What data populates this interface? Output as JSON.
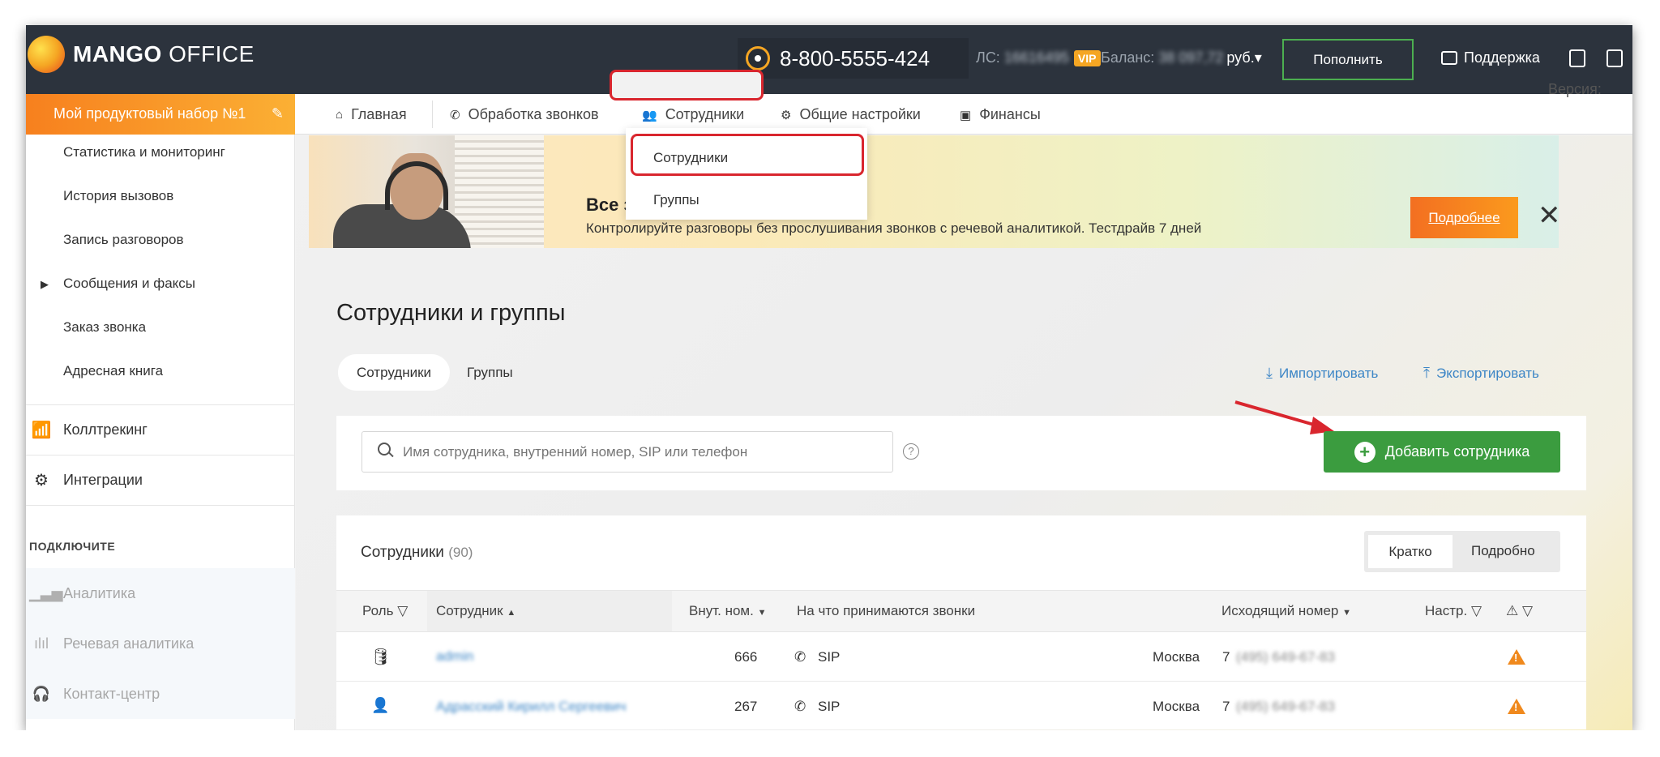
{
  "topbar": {
    "logo_bold": "MANGO",
    "logo_light": " OFFICE",
    "phone": "8-800-5555-424",
    "ls_label": "ЛС:",
    "ls_value": "16616495",
    "vip": "VIP",
    "balance_label": "Баланс:",
    "balance_value": "38 097,72",
    "balance_currency": "руб.▾",
    "topup_label": "Пополнить",
    "support_label": "Поддержка"
  },
  "sidebar": {
    "product_set": "Мой продуктовый набор №1",
    "items": [
      {
        "label": "Статистика и мониторинг"
      },
      {
        "label": "История вызовов"
      },
      {
        "label": "Запись разговоров"
      },
      {
        "label": "Сообщения и факсы"
      },
      {
        "label": "Заказ звонка"
      },
      {
        "label": "Адресная книга"
      }
    ],
    "big_items": [
      {
        "label": "Коллтрекинг",
        "icon": "calltracking-icon"
      },
      {
        "label": "Интеграции",
        "icon": "integrations-icon"
      }
    ],
    "section_title": "ПОДКЛЮЧИТЕ",
    "connect_items": [
      {
        "label": "Аналитика",
        "icon": "bar-chart-icon"
      },
      {
        "label": "Речевая аналитика",
        "icon": "waveform-icon"
      },
      {
        "label": "Контакт-центр",
        "icon": "headset-icon"
      }
    ]
  },
  "nav": {
    "home": "Главная",
    "calls": "Обработка звонков",
    "employees": "Сотрудники",
    "settings": "Общие настройки",
    "finance": "Финансы",
    "version": "Версия:"
  },
  "dropdown": {
    "items": [
      "Сотрудники",
      "Группы"
    ]
  },
  "banner": {
    "title": "Все з",
    "text": "Контролируйте разговоры без прослушивания звонков с речевой аналитикой. Тестдрайв 7 дней",
    "button": "Подробнее",
    "close": "✕"
  },
  "main": {
    "title": "Сотрудники и группы",
    "tabs": [
      "Сотрудники",
      "Группы"
    ],
    "import": "Импортировать",
    "export": "Экспортировать",
    "search_placeholder": "Имя сотрудника, внутренний номер, SIP или телефон",
    "help": "?",
    "add_button": "Добавить сотрудника"
  },
  "table": {
    "title": "Сотрудники",
    "count": "(90)",
    "view_short": "Кратко",
    "view_detailed": "Подробно",
    "columns": [
      "Роль",
      "Сотрудник",
      "Внут. ном.",
      "На что принимаются звонки",
      "Исходящий номер",
      "Настр."
    ],
    "rows": [
      {
        "name": "admin",
        "ext": "666",
        "receive": "SIP",
        "city": "Москва",
        "out_prefix": "7",
        "out_number": "(495) 649-67-83"
      },
      {
        "name": "Адрасский Кирилл Сергеевич",
        "ext": "267",
        "receive": "SIP",
        "city": "Москва",
        "out_prefix": "7",
        "out_number": "(495) 649-67-83"
      }
    ]
  },
  "colors": {
    "topbar": "#2c333d",
    "accent_orange": "#f7801e",
    "add_green": "#3b9c3f",
    "highlight_red": "#d9262e",
    "link_blue": "#3d86c6",
    "warning": "#f0891d"
  }
}
